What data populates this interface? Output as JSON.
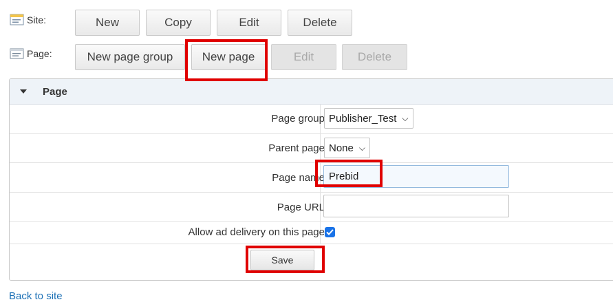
{
  "site_row": {
    "label": "Site:",
    "buttons": {
      "new": "New",
      "copy": "Copy",
      "edit": "Edit",
      "delete": "Delete"
    }
  },
  "page_row": {
    "label": "Page:",
    "buttons": {
      "new_group": "New page group",
      "new_page": "New page",
      "edit": "Edit",
      "delete": "Delete"
    }
  },
  "panel": {
    "title": "Page",
    "fields": {
      "page_group": {
        "label": "Page group",
        "value": "Publisher_Test"
      },
      "parent_page": {
        "label": "Parent page",
        "value": "None"
      },
      "page_name": {
        "label": "Page name",
        "value": "Prebid"
      },
      "page_url": {
        "label": "Page URL",
        "value": ""
      },
      "allow_ad": {
        "label": "Allow ad delivery on this page",
        "checked": true
      }
    },
    "save_label": "Save"
  },
  "back_link": "Back to site",
  "colors": {
    "highlight": "#e00000",
    "link": "#1a6fb5",
    "checkbox": "#1a73e8",
    "header_bg": "#eef3f8"
  }
}
